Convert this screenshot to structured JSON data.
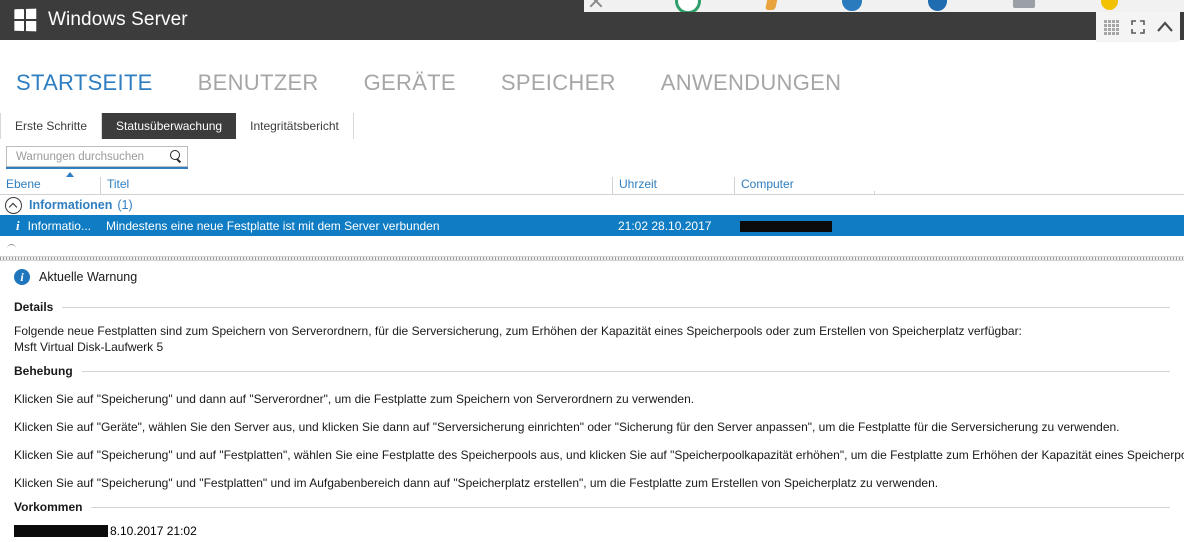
{
  "header": {
    "brand": "Windows Server",
    "logo_icon": "windows-logo-icon",
    "chrome": {
      "grid_icon": "app-grid-icon",
      "fullscreen_icon": "fullscreen-expand-icon",
      "collapse_icon": "chevron-up-icon"
    },
    "strip_icons": [
      "close-x-icon",
      "green-circle-icon",
      "orange-bookmark-icon",
      "blue-swirl-icon",
      "blue-arrow-icon",
      "gray-tile-icon",
      "yellow-dot-icon"
    ]
  },
  "nav": {
    "items": [
      {
        "label": "STARTSEITE",
        "active": true
      },
      {
        "label": "BENUTZER",
        "active": false
      },
      {
        "label": "GERÄTE",
        "active": false
      },
      {
        "label": "SPEICHER",
        "active": false
      },
      {
        "label": "ANWENDUNGEN",
        "active": false
      }
    ]
  },
  "subtabs": {
    "items": [
      {
        "label": "Erste Schritte",
        "active": false
      },
      {
        "label": "Statusüberwachung",
        "active": true
      },
      {
        "label": "Integritätsbericht",
        "active": false
      }
    ]
  },
  "search": {
    "placeholder": "Warnungen durchsuchen",
    "value": "",
    "icon": "search-icon"
  },
  "grid": {
    "columns": [
      {
        "key": "ebene",
        "label": "Ebene",
        "sorted": true
      },
      {
        "key": "titel",
        "label": "Titel",
        "sorted": false
      },
      {
        "key": "uhrzeit",
        "label": "Uhrzeit",
        "sorted": false
      },
      {
        "key": "computer",
        "label": "Computer",
        "sorted": false
      }
    ],
    "group": {
      "label": "Informationen",
      "count": "(1)",
      "expanded": true,
      "collapse_icon": "chevron-up-circle-icon"
    },
    "rows": [
      {
        "level_icon": "info-icon",
        "ebene": "Informatio...",
        "titel": "Mindestens eine neue Festplatte ist mit dem Server verbunden",
        "uhrzeit": "21:02 28.10.2017",
        "computer_redacted": true,
        "computer": "",
        "selected": true
      }
    ]
  },
  "detail": {
    "title": "Aktuelle Warnung",
    "title_icon": "info-icon",
    "sections": {
      "details_heading": "Details",
      "details_text_line1": "Folgende neue Festplatten sind zum Speichern von Serverordnern, für die Serversicherung, zum Erhöhen der Kapazität eines Speicherpools oder zum Erstellen von Speicherplatz verfügbar:",
      "details_text_line2": "Msft Virtual Disk-Laufwerk 5",
      "remediation_heading": "Behebung",
      "remediation_steps": [
        "Klicken Sie auf \"Speicherung\" und dann auf \"Serverordner\", um die Festplatte zum Speichern von Serverordnern zu verwenden.",
        "Klicken Sie auf \"Geräte\", wählen Sie den Server aus, und klicken Sie dann auf \"Serversicherung einrichten\" oder \"Sicherung für den Server anpassen\", um die Festplatte für die Serversicherung zu verwenden.",
        "Klicken Sie auf \"Speicherung\" und auf \"Festplatten\", wählen Sie eine Festplatte des Speicherpools aus, und klicken Sie auf \"Speicherpoolkapazität erhöhen\", um die Festplatte zum Erhöhen der Kapazität eines Speicherpools zu verwenden.",
        "Klicken Sie auf \"Speicherung\" und \"Festplatten\" und im Aufgabenbereich dann auf \"Speicherplatz erstellen\", um die Festplatte zum Erstellen von Speicherplatz zu verwenden."
      ],
      "occurrence_heading": "Vorkommen",
      "occurrence_value": "8.10.2017 21:02"
    }
  },
  "colors": {
    "header_bg": "#3c3c3c",
    "accent_blue": "#2e7ec1",
    "selection_blue": "#0f7cc3",
    "nav_inactive": "#a6a6a6"
  }
}
